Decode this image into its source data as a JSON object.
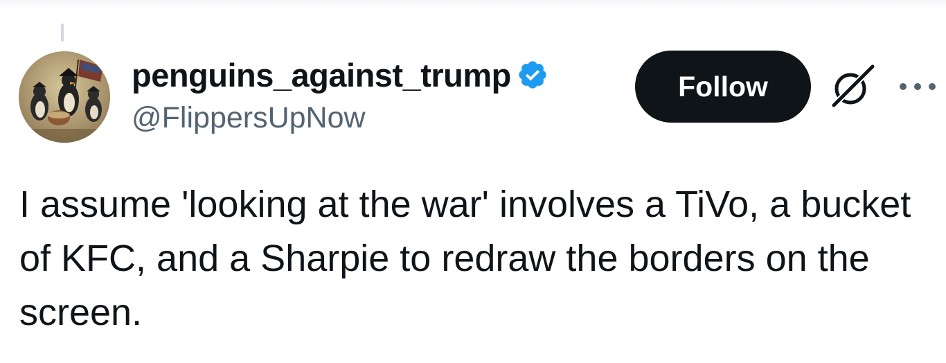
{
  "tweet": {
    "author": {
      "display_name": "penguins_against_trump",
      "handle": "@FlippersUpNow",
      "verified": true,
      "avatar_description_icon": "penguin-painting-avatar"
    },
    "follow_button_label": "Follow",
    "text": "I assume 'looking at the war' involves a TiVo, a bucket of KFC, and a Sharpie to redraw the borders on the screen."
  },
  "icons": {
    "verified": "verified-badge-icon",
    "grok": "grok-icon",
    "more": "more-options-icon"
  },
  "colors": {
    "text_primary": "#0f1419",
    "text_secondary": "#536471",
    "verified_blue": "#1d9bf0",
    "button_bg": "#0f1419",
    "button_text": "#ffffff"
  }
}
